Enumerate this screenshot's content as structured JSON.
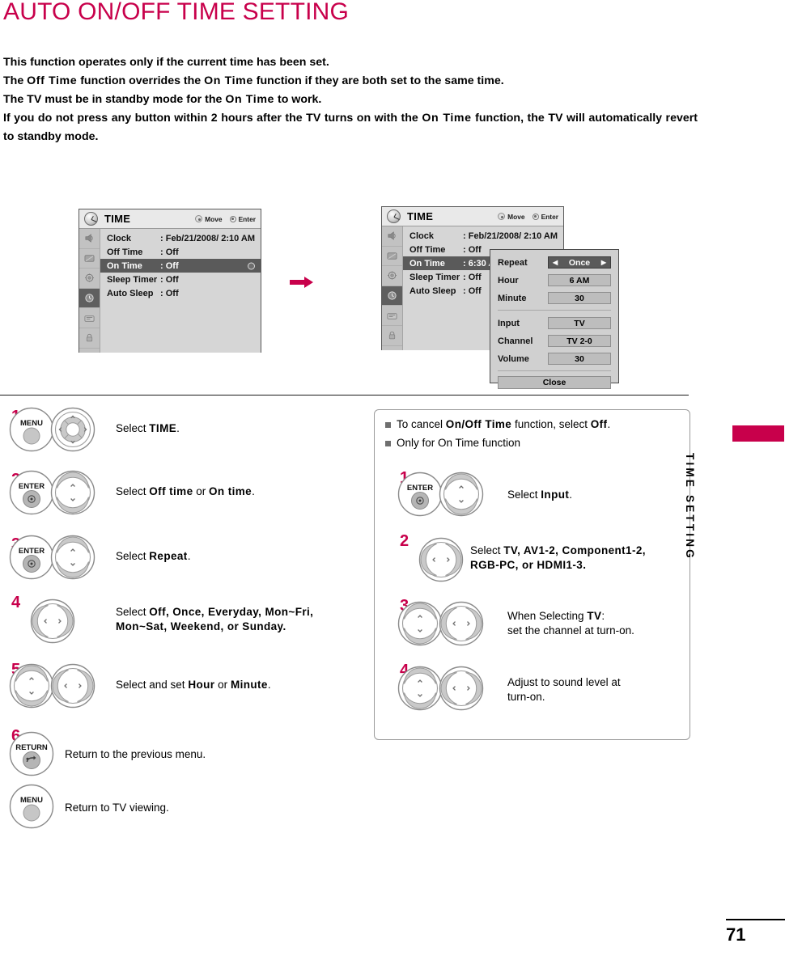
{
  "page": {
    "title": "AUTO ON/OFF TIME SETTING",
    "number": "71",
    "side_tab": "TIME SETTING",
    "accent_color": "#c8004b"
  },
  "intro": {
    "l1": "This function operates only if the current time has been set.",
    "l2a": "The ",
    "l2b": "Off Time",
    "l2c": " function overrides the ",
    "l2d": "On Time",
    "l2e": " function if they are both set to the same time.",
    "l3a": "The TV must be in standby mode for the ",
    "l3b": "On Time",
    "l3c": " to work.",
    "l4a": "If you do not press any button within 2 hours after the TV turns on with the ",
    "l4b": "On Time",
    "l4c": " function, the TV will automatically revert to standby mode."
  },
  "osd": {
    "title": "TIME",
    "hint_move": "Move",
    "hint_enter": "Enter",
    "rail_icons": [
      "audio-icon",
      "picture-icon",
      "setup-icon",
      "time-icon",
      "channel-icon",
      "lock-icon"
    ],
    "left": {
      "rows": [
        {
          "key": "Clock",
          "value": ": Feb/21/2008/  2:10 AM",
          "highlight": false,
          "marker": false
        },
        {
          "key": "Off Time",
          "value": ": Off",
          "highlight": false,
          "marker": false
        },
        {
          "key": "On Time",
          "value": ": Off",
          "highlight": true,
          "marker": true
        },
        {
          "key": "Sleep Timer",
          "value": ": Off",
          "highlight": false,
          "marker": false
        },
        {
          "key": "Auto Sleep",
          "value": ": Off",
          "highlight": false,
          "marker": false
        }
      ]
    },
    "right": {
      "rows": [
        {
          "key": "Clock",
          "value": ": Feb/21/2008/  2:10 AM",
          "highlight": false,
          "marker": false
        },
        {
          "key": "Off Time",
          "value": ": Off",
          "highlight": false,
          "marker": false
        },
        {
          "key": "On Time",
          "value": ": 6:30 AM",
          "highlight": true,
          "marker": false
        },
        {
          "key": "Sleep Timer",
          "value": ": Off",
          "highlight": false,
          "marker": false
        },
        {
          "key": "Auto Sleep",
          "value": ": Off",
          "highlight": false,
          "marker": false
        }
      ]
    }
  },
  "on_time_panel": {
    "repeat_label": "Repeat",
    "repeat_value": "Once",
    "arrow_left": "◀",
    "arrow_right": "▶",
    "hour_label": "Hour",
    "hour_value": "6 AM",
    "minute_label": "Minute",
    "minute_value": "30",
    "input_label": "Input",
    "input_value": "TV",
    "channel_label": "Channel",
    "channel_value": "TV 2-0",
    "volume_label": "Volume",
    "volume_value": "30",
    "close_label": "Close"
  },
  "steps_left": [
    {
      "num": "1",
      "btn1": "MENU",
      "btn2": "nav-4way",
      "text_pre": "Select ",
      "text_bold": "TIME",
      "text_post": "."
    },
    {
      "num": "2",
      "btn1": "ENTER",
      "btn2": "nav-updown",
      "text_pre": "Select ",
      "text_bold": "Off time",
      "text_mid": " or ",
      "text_bold2": "On time",
      "text_post": "."
    },
    {
      "num": "3",
      "btn1": "ENTER",
      "btn2": "nav-updown",
      "text_pre": "Select ",
      "text_bold": "Repeat",
      "text_post": "."
    },
    {
      "num": "4",
      "btn1": "nav-leftright",
      "line1_pre": "Select ",
      "line1": "Off, Once, Everyday, Mon~Fri,",
      "line2": "Mon~Sat, Weekend, or Sunday."
    },
    {
      "num": "5",
      "btn1": "nav-updown",
      "btn2": "nav-leftright",
      "text_pre": "Select and set ",
      "text_bold": "Hour",
      "text_mid": " or ",
      "text_bold2": "Minute",
      "text_post": "."
    },
    {
      "num": "6",
      "btn1": "RETURN",
      "text": "Return to the previous menu."
    },
    {
      "num": "",
      "btn1": "MENU",
      "text": "Return to TV viewing."
    }
  ],
  "note_box": {
    "bullet1_pre": "To cancel ",
    "bullet1_bold": "On/Off Time",
    "bullet1_mid": " function, select ",
    "bullet1_bold2": "Off",
    "bullet1_post": ".",
    "bullet2": "Only for On Time function",
    "steps": [
      {
        "num": "1",
        "btn1": "ENTER",
        "btn2": "nav-updown",
        "text_pre": "Select ",
        "text_bold": "Input",
        "text_post": "."
      },
      {
        "num": "2",
        "btn1": "nav-leftright",
        "line1_pre": "Select ",
        "line1": "TV, AV1-2, Component1-2,",
        "line2": "RGB-PC, or HDMI1-3."
      },
      {
        "num": "3",
        "btn1": "nav-updown",
        "btn2": "nav-leftright",
        "line1_pre": "When Selecting ",
        "line1_bold": "TV",
        "line1_post": ":",
        "line2": "set the channel at turn-on."
      },
      {
        "num": "4",
        "btn1": "nav-updown",
        "btn2": "nav-leftright",
        "line1": "Adjust to sound level at",
        "line2": "turn-on."
      }
    ]
  },
  "labels": {
    "menu": "MENU",
    "enter": "ENTER",
    "return": "RETURN"
  }
}
